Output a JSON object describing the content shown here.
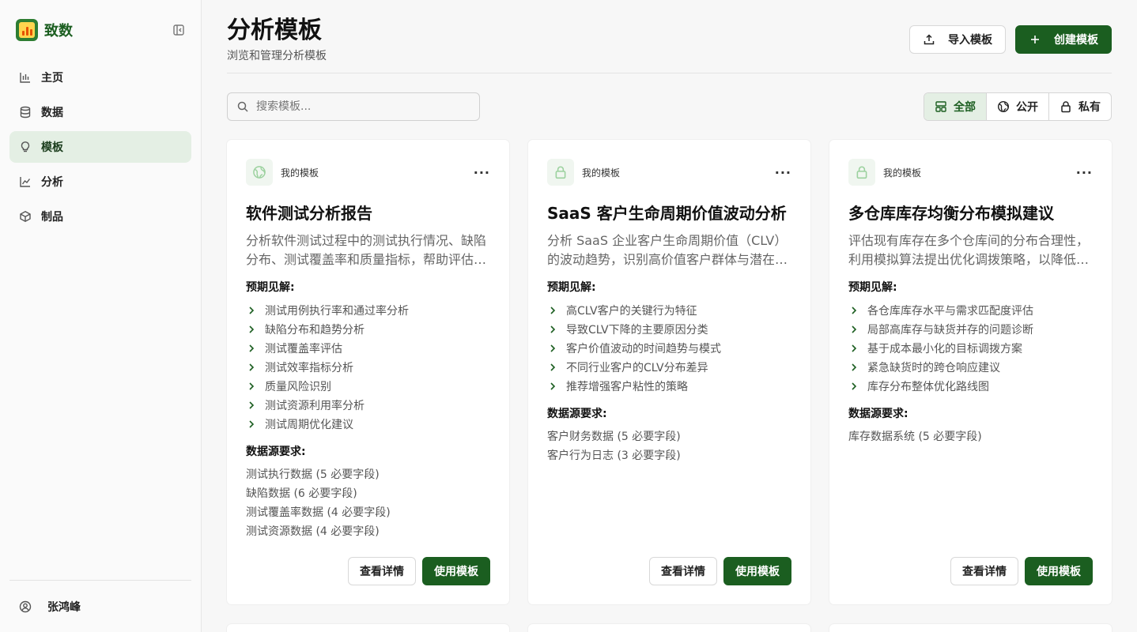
{
  "sidebar": {
    "brand": "致数",
    "nav": [
      {
        "label": "主页",
        "icon": "bar-chart-icon"
      },
      {
        "label": "数据",
        "icon": "database-icon"
      },
      {
        "label": "模板",
        "icon": "lightbulb-icon",
        "active": true
      },
      {
        "label": "分析",
        "icon": "line-chart-icon"
      },
      {
        "label": "制品",
        "icon": "cube-icon"
      }
    ],
    "user": "张鸿峰"
  },
  "header": {
    "title": "分析模板",
    "subtitle": "浏览和管理分析模板",
    "import_label": "导入模板",
    "create_label": "创建模板"
  },
  "search": {
    "placeholder": "搜索模板..."
  },
  "filters": {
    "all": "全部",
    "public": "公开",
    "private": "私有"
  },
  "card_labels": {
    "insights_label": "预期见解:",
    "sources_label": "数据源要求:",
    "details_label": "查看详情",
    "use_label": "使用模板"
  },
  "cards": [
    {
      "owner": "我的模板",
      "visibility": "public",
      "title": "软件测试分析报告",
      "desc": "分析软件测试过程中的测试执行情况、缺陷分布、测试覆盖率和质量指标，帮助评估软件质量并优化测试流程",
      "insights": [
        "测试用例执行率和通过率分析",
        "缺陷分布和趋势分析",
        "测试覆盖率评估",
        "测试效率指标分析",
        "质量风险识别",
        "测试资源利用率分析",
        "测试周期优化建议"
      ],
      "sources": [
        "测试执行数据 (5 必要字段)",
        "缺陷数据 (6 必要字段)",
        "测试覆盖率数据 (4 必要字段)",
        "测试资源数据 (4 必要字段)"
      ]
    },
    {
      "owner": "我的模板",
      "visibility": "private",
      "title": "SaaS 客户生命周期价值波动分析",
      "desc": "分析 SaaS 企业客户生命周期价值（CLV）的波动趋势，识别高价值客户群体与潜在流失风险",
      "insights": [
        "高CLV客户的关键行为特征",
        "导致CLV下降的主要原因分类",
        "客户价值波动的时间趋势与模式",
        "不同行业客户的CLV分布差异",
        "推荐增强客户粘性的策略"
      ],
      "sources": [
        "客户财务数据 (5 必要字段)",
        "客户行为日志 (3 必要字段)"
      ]
    },
    {
      "owner": "我的模板",
      "visibility": "private",
      "title": "多仓库库存均衡分布模拟建议",
      "desc": "评估现有库存在多个仓库间的分布合理性，利用模拟算法提出优化调拨策略，以降低缺货与积压风险",
      "insights": [
        "各仓库库存水平与需求匹配度评估",
        "局部高库存与缺货并存的问题诊断",
        "基于成本最小化的目标调拨方案",
        "紧急缺货时的跨仓响应建议",
        "库存分布整体优化路线图"
      ],
      "sources": [
        "库存数据系统 (5 必要字段)"
      ]
    }
  ]
}
